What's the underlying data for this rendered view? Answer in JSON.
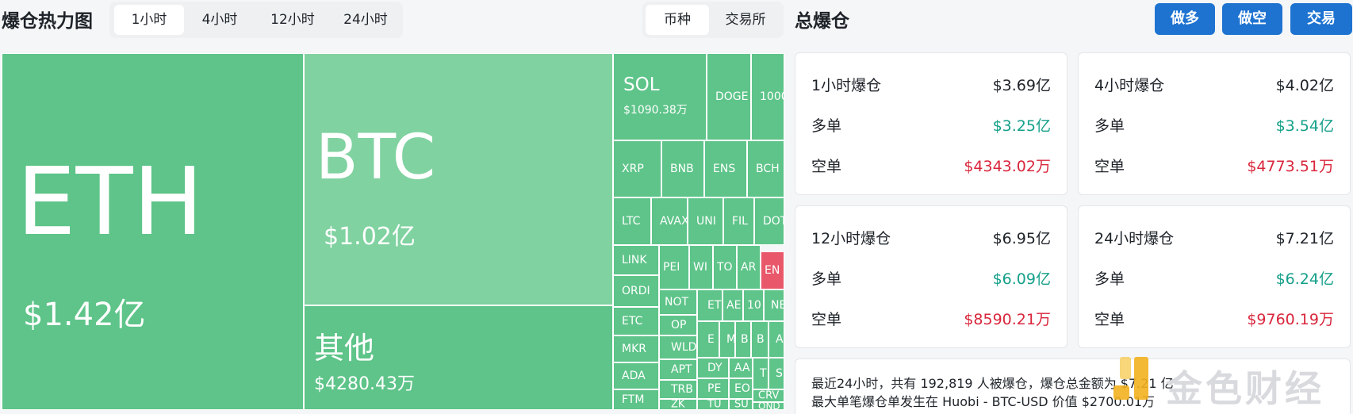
{
  "header": {
    "heatmap_title": "爆仓热力图",
    "time_tabs": [
      "1小时",
      "4小时",
      "12小时",
      "24小时"
    ],
    "view_tabs": [
      "币种",
      "交易所"
    ],
    "total_title": "总爆仓",
    "actions": [
      "做多",
      "做空",
      "交易"
    ]
  },
  "heatmap": {
    "eth": {
      "name": "ETH",
      "value": "$1.42亿"
    },
    "btc": {
      "name": "BTC",
      "value": "$1.02亿"
    },
    "others": {
      "name": "其他",
      "value": "$4280.43万"
    },
    "sol": {
      "name": "SOL",
      "value": "$1090.38万"
    },
    "coins": [
      "DOGE",
      "1000",
      "XRP",
      "BNB",
      "ENS",
      "BCH",
      "LTC",
      "AVAX",
      "UNI",
      "FIL",
      "DOT",
      "LINK",
      "PEI",
      "WI",
      "TO",
      "AR",
      "EN",
      "ORDI",
      "NOT",
      "ET",
      "AE",
      "10",
      "NE",
      "ETC",
      "OP",
      "MKR",
      "WLD",
      "E",
      "M",
      "B",
      "B",
      "A",
      "APT",
      "DY",
      "AA",
      "T",
      "S",
      "ADA",
      "TRB",
      "PE",
      "EO",
      "CRV",
      "FTM",
      "ZK",
      "TU",
      "SU",
      "OND"
    ]
  },
  "cards": [
    {
      "title": "1小时爆仓",
      "total": "$3.69亿",
      "long_label": "多单",
      "long": "$3.25亿",
      "short_label": "空单",
      "short": "$4343.02万"
    },
    {
      "title": "4小时爆仓",
      "total": "$4.02亿",
      "long_label": "多单",
      "long": "$3.54亿",
      "short_label": "空单",
      "short": "$4773.51万"
    },
    {
      "title": "12小时爆仓",
      "total": "$6.95亿",
      "long_label": "多单",
      "long": "$6.09亿",
      "short_label": "空单",
      "short": "$8590.21万"
    },
    {
      "title": "24小时爆仓",
      "total": "$7.21亿",
      "long_label": "多单",
      "long": "$6.24亿",
      "short_label": "空单",
      "short": "$9760.19万"
    }
  ],
  "summary": {
    "line1": "最近24小时，共有 192,819 人被爆仓，爆仓总金额为 $7.21 亿",
    "line2": "最大单笔爆仓单发生在 Huobi - BTC-USD 价值 $2700.01万"
  },
  "watermark": "金色财经",
  "colors": {
    "long_tile": "#5ec489",
    "short_tile": "#e8586a",
    "accent_button": "#1e73d1",
    "long_text": "#15a08a",
    "short_text": "#d9263c"
  }
}
